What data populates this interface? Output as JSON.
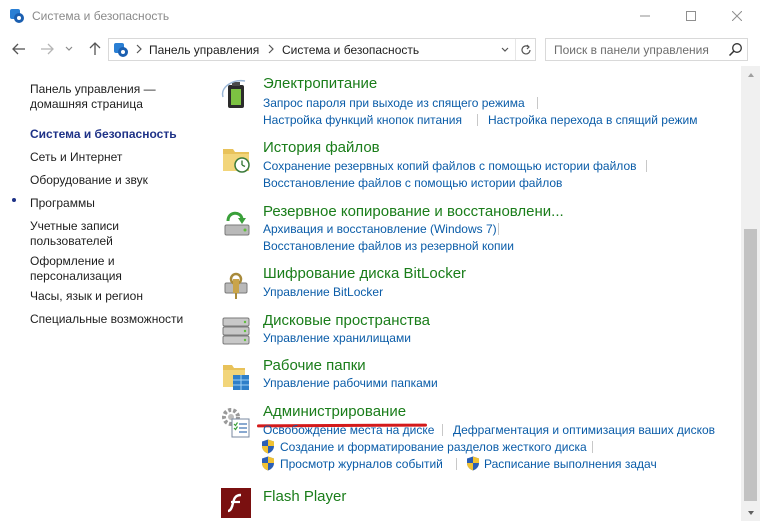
{
  "window": {
    "title": "Система и безопасность"
  },
  "navigation": {
    "breadcrumbs": [
      "Панель управления",
      "Система и безопасность"
    ],
    "search_placeholder": "Поиск в панели управления"
  },
  "sidebar": {
    "items": [
      {
        "label": "Панель управления — домашняя страница",
        "active": false
      },
      {
        "label": "Система и безопасность",
        "active": true
      },
      {
        "label": "Сеть и Интернет",
        "active": false
      },
      {
        "label": "Оборудование и звук",
        "active": false
      },
      {
        "label": "Программы",
        "active": false
      },
      {
        "label": "Учетные записи пользователей",
        "active": false
      },
      {
        "label": "Оформление и персонализация",
        "active": false
      },
      {
        "label": "Часы, язык и регион",
        "active": false
      },
      {
        "label": "Специальные возможности",
        "active": false
      }
    ]
  },
  "categories": [
    {
      "title": "Электропитание",
      "icon": "power-battery-icon",
      "links": [
        "Запрос пароля при выходе из спящего режима",
        "Настройка функций кнопок питания",
        "Настройка перехода в спящий режим"
      ]
    },
    {
      "title": "История файлов",
      "icon": "file-history-icon",
      "links": [
        "Сохранение резервных копий файлов с помощью истории файлов",
        "Восстановление файлов с помощью истории файлов"
      ]
    },
    {
      "title": "Резервное копирование и восстановлени...",
      "icon": "backup-restore-icon",
      "links": [
        "Архивация и восстановление (Windows 7)",
        "Восстановление файлов из резервной копии"
      ]
    },
    {
      "title": "Шифрование диска BitLocker",
      "icon": "bitlocker-icon",
      "links": [
        "Управление BitLocker"
      ]
    },
    {
      "title": "Дисковые пространства",
      "icon": "storage-spaces-icon",
      "links": [
        "Управление хранилищами"
      ]
    },
    {
      "title": "Рабочие папки",
      "icon": "work-folders-icon",
      "links": [
        "Управление рабочими папками"
      ]
    },
    {
      "title": "Администрирование",
      "icon": "administrative-tools-icon",
      "links": [
        "Освобождение места на диске",
        "Дефрагментация и оптимизация ваших дисков",
        "Создание и форматирование разделов жесткого диска",
        "Просмотр журналов событий",
        "Расписание выполнения задач"
      ]
    },
    {
      "title": "Flash Player",
      "icon": "flash-player-icon",
      "links": []
    }
  ],
  "colors": {
    "category_title": "#1a7d1a",
    "link": "#0a5ca8",
    "active_sidebar": "#1e3287",
    "annotation_underline": "#d41a1a"
  }
}
